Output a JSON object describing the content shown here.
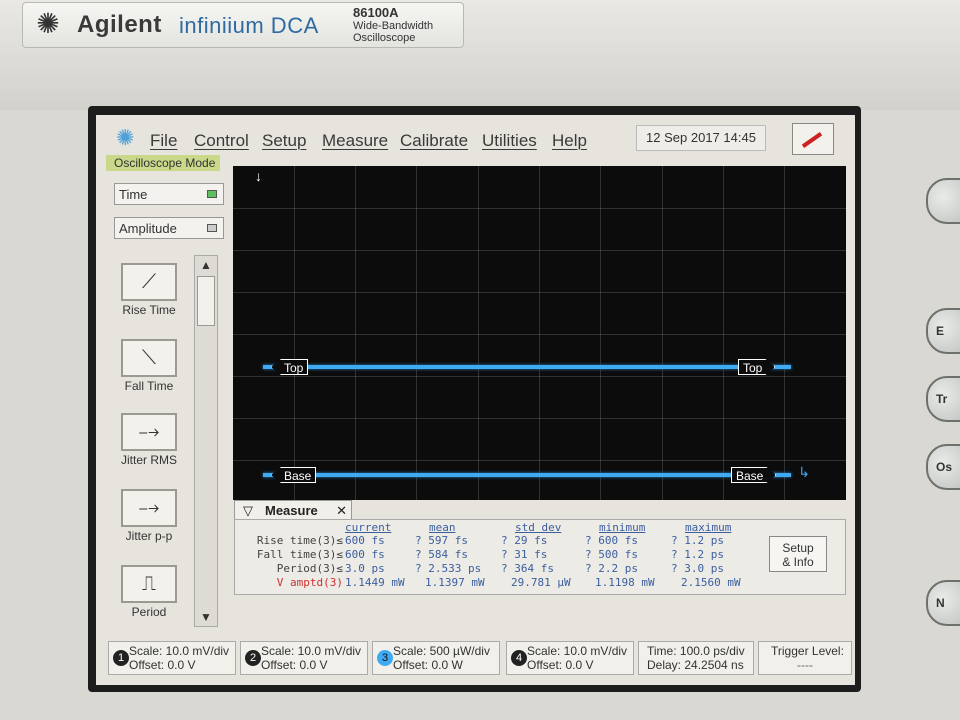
{
  "instrument": {
    "brand": "Agilent",
    "product": "infiniium DCA",
    "model": "86100A",
    "model_desc_line1": "Wide-Bandwidth",
    "model_desc_line2": "Oscilloscope"
  },
  "side_buttons": [
    "",
    "E",
    "Tr",
    "Os",
    "N"
  ],
  "menu": {
    "items": [
      "File",
      "Control",
      "Setup",
      "Measure",
      "Calibrate",
      "Utilities",
      "Help"
    ],
    "datetime": "12 Sep 2017   14:45"
  },
  "sidebar": {
    "mode_label": "Oscilloscope Mode",
    "dropdown1": "Time",
    "dropdown2": "Amplitude",
    "tools": [
      {
        "label": "Rise Time",
        "icon": "rise-time-icon",
        "glyph": "⟋"
      },
      {
        "label": "Fall Time",
        "icon": "fall-time-icon",
        "glyph": "⟍"
      },
      {
        "label": "Jitter RMS",
        "icon": "jitter-rms-icon",
        "glyph": "⤍"
      },
      {
        "label": "Jitter p-p",
        "icon": "jitter-pp-icon",
        "glyph": "⤍"
      },
      {
        "label": "Period",
        "icon": "period-icon",
        "glyph": "⎍"
      }
    ],
    "scroll_up": "▲",
    "scroll_down": "▼"
  },
  "display": {
    "marker_top": "Top",
    "marker_base": "Base",
    "arrow_top": "↓",
    "arrow_base": "↳",
    "trace_color": "#3fa9f2"
  },
  "measure": {
    "tab_label": "Measure",
    "tab_close": "✕",
    "tab_chevron": "▽",
    "headers": [
      "current",
      "mean",
      "std dev",
      "minimum",
      "maximum"
    ],
    "rows": [
      {
        "label": "Rise time(3)≤",
        "current": "600 fs",
        "mean": "? 597 fs",
        "std": "? 29 fs",
        "min": "? 600 fs",
        "max": "? 1.2 ps"
      },
      {
        "label": "Fall time(3)≤",
        "current": "600 fs",
        "mean": "? 584 fs",
        "std": "? 31 fs",
        "min": "? 500 fs",
        "max": "? 1.2 ps"
      },
      {
        "label": "Period(3)≤",
        "current": "3.0 ps",
        "mean": "? 2.533 ps",
        "std": "? 364 fs",
        "min": "? 2.2 ps",
        "max": "? 3.0 ps"
      },
      {
        "label": "V amptd(3)",
        "current": "1.1449 mW",
        "mean": "1.1397 mW",
        "std": "29.781 µW",
        "min": "1.1198 mW",
        "max": "2.1560 mW"
      }
    ],
    "setup_line1": "Setup",
    "setup_line2": "& Info",
    "highlight_color": "#d03030"
  },
  "channels": [
    {
      "num": "1",
      "scale": "Scale: 10.0 mV/div",
      "offset": "Offset: 0.0 V"
    },
    {
      "num": "2",
      "scale": "Scale: 10.0 mV/div",
      "offset": "Offset: 0.0 V"
    },
    {
      "num": "3",
      "scale": "Scale: 500 µW/div",
      "offset": "Offset: 0.0 W"
    },
    {
      "num": "4",
      "scale": "Scale: 10.0 mV/div",
      "offset": "Offset: 0.0 V"
    }
  ],
  "timebase": {
    "time": "Time: 100.0 ps/div",
    "delay": "Delay: 24.2504 ns"
  },
  "trigger": {
    "label": "Trigger Level:",
    "value": "----"
  }
}
